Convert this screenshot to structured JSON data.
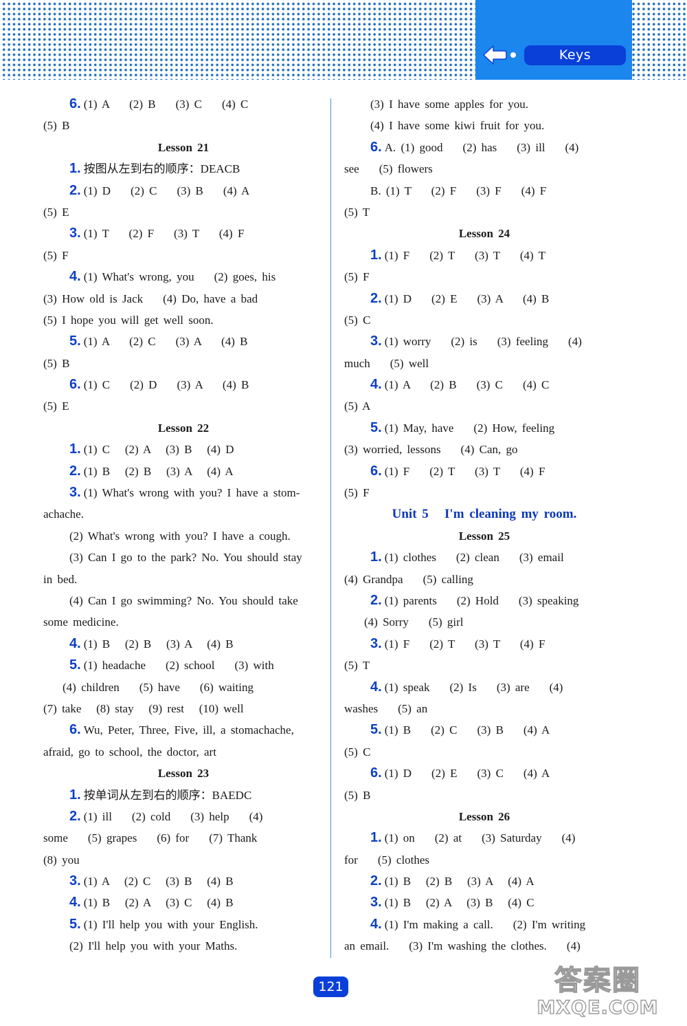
{
  "header": {
    "section_label": "Keys",
    "back_icon": "back-arrow-icon",
    "colors": {
      "panel": "#1b86ee",
      "pill": "#0a3fd8",
      "dots": "#1f6fc2"
    }
  },
  "left_column": [
    {
      "type": "item",
      "num": "6.",
      "text": "(1) A    (2) B    (3) C    (4) C"
    },
    {
      "type": "cont",
      "text": "(5) B"
    },
    {
      "type": "heading",
      "text": "Lesson 21"
    },
    {
      "type": "item",
      "num": "1.",
      "text": "按图从左到右的顺序：DEACB"
    },
    {
      "type": "item",
      "num": "2.",
      "text": "(1) D    (2) C    (3) B    (4) A"
    },
    {
      "type": "cont",
      "text": "(5) E"
    },
    {
      "type": "item",
      "num": "3.",
      "text": "(1) T    (2) F    (3) T    (4) F"
    },
    {
      "type": "cont",
      "text": "(5) F"
    },
    {
      "type": "item",
      "num": "4.",
      "text": "(1) What's wrong, you    (2) goes, his"
    },
    {
      "type": "cont",
      "text": "(3) How old is Jack    (4) Do, have a bad"
    },
    {
      "type": "cont",
      "text": "(5) I hope you will get well soon."
    },
    {
      "type": "item",
      "num": "5.",
      "text": "(1) A    (2) C    (3) A    (4) B"
    },
    {
      "type": "cont",
      "text": "(5) B"
    },
    {
      "type": "item",
      "num": "6.",
      "text": "(1) C    (2) D    (3) A    (4) B"
    },
    {
      "type": "cont",
      "text": "(5) E"
    },
    {
      "type": "heading",
      "text": "Lesson 22"
    },
    {
      "type": "item",
      "num": "1.",
      "text": "(1) C   (2) A   (3) B   (4) D"
    },
    {
      "type": "item",
      "num": "2.",
      "text": "(1) B   (2) B   (3) A   (4) A"
    },
    {
      "type": "item",
      "num": "3.",
      "text": "(1) What's wrong with you? I have a stom-"
    },
    {
      "type": "cont",
      "text": "achache."
    },
    {
      "type": "sub",
      "text": "(2) What's wrong with you? I have a cough."
    },
    {
      "type": "sub",
      "text": "(3) Can I go to the park? No. You should stay"
    },
    {
      "type": "cont",
      "text": "in bed."
    },
    {
      "type": "sub",
      "text": "(4) Can I go swimming? No. You should take"
    },
    {
      "type": "cont",
      "text": "some medicine."
    },
    {
      "type": "item",
      "num": "4.",
      "text": "(1) B   (2) B   (3) A   (4) B"
    },
    {
      "type": "item",
      "num": "5.",
      "text": "(1) headache    (2) school    (3) with"
    },
    {
      "type": "sub2",
      "text": "(4) children    (5) have    (6) waiting"
    },
    {
      "type": "cont",
      "text": "(7) take   (8) stay   (9) rest   (10) well"
    },
    {
      "type": "item",
      "num": "6.",
      "text": "Wu, Peter, Three, Five, ill, a stomachache,"
    },
    {
      "type": "cont",
      "text": "afraid, go to school, the doctor, art"
    },
    {
      "type": "heading",
      "text": "Lesson 23"
    },
    {
      "type": "item",
      "num": "1.",
      "text": "按单词从左到右的顺序：BAEDC"
    },
    {
      "type": "item",
      "num": "2.",
      "text": "(1) ill    (2) cold    (3) help    (4)"
    },
    {
      "type": "cont",
      "text": "some    (5) grapes    (6) for    (7) Thank"
    },
    {
      "type": "cont",
      "text": "(8) you"
    },
    {
      "type": "item",
      "num": "3.",
      "text": "(1) A   (2) C   (3) B   (4) B"
    },
    {
      "type": "item",
      "num": "4.",
      "text": "(1) B   (2) A   (3) C   (4) B"
    },
    {
      "type": "item",
      "num": "5.",
      "text": "(1) I'll help you with your English."
    },
    {
      "type": "sub",
      "text": "(2) I'll help you with your Maths."
    }
  ],
  "right_column": [
    {
      "type": "sub",
      "text": "(3) I have some apples for you."
    },
    {
      "type": "sub",
      "text": "(4) I have some kiwi fruit for you."
    },
    {
      "type": "item",
      "num": "6.",
      "text": "A. (1) good    (2) has    (3) ill    (4)"
    },
    {
      "type": "cont",
      "text": "see    (5) flowers"
    },
    {
      "type": "sub",
      "text": "B. (1) T    (2) F    (3) F    (4) F"
    },
    {
      "type": "cont",
      "text": "(5) T"
    },
    {
      "type": "heading",
      "text": "Lesson 24"
    },
    {
      "type": "item",
      "num": "1.",
      "text": "(1) F    (2) T    (3) T    (4) T"
    },
    {
      "type": "cont",
      "text": "(5) F"
    },
    {
      "type": "item",
      "num": "2.",
      "text": "(1) D    (2) E    (3) A    (4) B"
    },
    {
      "type": "cont",
      "text": "(5) C"
    },
    {
      "type": "item",
      "num": "3.",
      "text": "(1) worry    (2) is    (3) feeling    (4)"
    },
    {
      "type": "cont",
      "text": "much    (5) well"
    },
    {
      "type": "item",
      "num": "4.",
      "text": "(1) A    (2) B    (3) C    (4) C"
    },
    {
      "type": "cont",
      "text": "(5) A"
    },
    {
      "type": "item",
      "num": "5.",
      "text": "(1) May, have    (2) How, feeling"
    },
    {
      "type": "cont",
      "text": "(3) worried, lessons    (4) Can, go"
    },
    {
      "type": "item",
      "num": "6.",
      "text": "(1) F    (2) T    (3) T    (4) F"
    },
    {
      "type": "cont",
      "text": "(5) F"
    },
    {
      "type": "unit",
      "text": "Unit 5   I'm cleaning my room."
    },
    {
      "type": "heading",
      "text": "Lesson 25"
    },
    {
      "type": "item",
      "num": "1.",
      "text": "(1) clothes    (2) clean    (3) email"
    },
    {
      "type": "cont",
      "text": "(4) Grandpa    (5) calling"
    },
    {
      "type": "item",
      "num": "2.",
      "text": "(1) parents    (2) Hold    (3) speaking"
    },
    {
      "type": "sub3",
      "text": "(4) Sorry    (5) girl"
    },
    {
      "type": "item",
      "num": "3.",
      "text": "(1) F    (2) T    (3) T    (4) F"
    },
    {
      "type": "cont",
      "text": "(5) T"
    },
    {
      "type": "item",
      "num": "4.",
      "text": "(1) speak    (2) Is    (3) are    (4)"
    },
    {
      "type": "cont",
      "text": "washes    (5) an"
    },
    {
      "type": "item",
      "num": "5.",
      "text": "(1) B    (2) C    (3) B    (4) A"
    },
    {
      "type": "cont",
      "text": "(5) C"
    },
    {
      "type": "item",
      "num": "6.",
      "text": "(1) D    (2) E    (3) C    (4) A"
    },
    {
      "type": "cont",
      "text": "(5) B"
    },
    {
      "type": "heading",
      "text": "Lesson 26"
    },
    {
      "type": "item",
      "num": "1.",
      "text": "(1) on    (2) at    (3) Saturday    (4)"
    },
    {
      "type": "cont",
      "text": "for    (5) clothes"
    },
    {
      "type": "item",
      "num": "2.",
      "text": "(1) B   (2) B   (3) A   (4) A"
    },
    {
      "type": "item",
      "num": "3.",
      "text": "(1) B   (2) A   (3) B   (4) C"
    },
    {
      "type": "item",
      "num": "4.",
      "text": "(1) I'm making a call.    (2) I'm writing"
    },
    {
      "type": "cont",
      "text": "an email.    (3) I'm washing the clothes.    (4)"
    }
  ],
  "footer": {
    "page_number": "121",
    "watermark_top": "答案圈",
    "watermark_bottom": "MXQE.COM"
  }
}
